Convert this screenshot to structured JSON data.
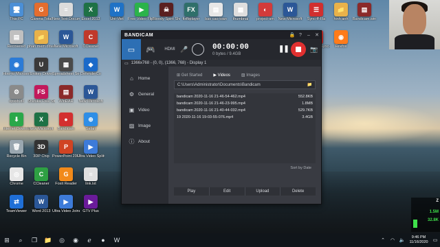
{
  "desktop": {
    "icons": [
      {
        "label": "This PC",
        "glyph": "🖥",
        "color": "#4b8fd6"
      },
      {
        "label": "Garena Total",
        "glyph": "G",
        "color": "#e46d2e"
      },
      {
        "label": "New Text Document",
        "glyph": "≡",
        "color": "#dcdcdc"
      },
      {
        "label": "Excel 2013",
        "glyph": "X",
        "color": "#1e7145"
      },
      {
        "label": "Uni-Viet",
        "glyph": "W",
        "color": "#1f72c6"
      },
      {
        "label": "Free Video Flip and",
        "glyph": "▶",
        "color": "#2bb34a"
      },
      {
        "label": "Bloody Spirit Shooter",
        "glyph": "☠",
        "color": "#5a2020"
      },
      {
        "label": "fixfbplayer",
        "glyph": "FX",
        "color": "#2f6f6a"
      },
      {
        "label": "bao cao toan",
        "glyph": "▤",
        "color": "#e7e7e7"
      },
      {
        "label": "thumbnai",
        "glyph": "▦",
        "color": "#dedede"
      },
      {
        "label": "project-sm",
        "glyph": "◐",
        "color": "#d33b3b"
      },
      {
        "label": "New Microsoft",
        "glyph": "W",
        "color": "#2b5797"
      },
      {
        "label": "Sync-ff-Fla",
        "glyph": "☰",
        "color": "#d12f2f"
      },
      {
        "label": "hinh anh",
        "glyph": "📁",
        "color": "#e8b24a"
      },
      {
        "label": "Bandicam.win",
        "glyph": "▤",
        "color": "#8b2a2a"
      },
      {
        "label": "Recovered",
        "glyph": "▤",
        "color": "#c0c0c0"
      },
      {
        "label": "phan mem driver",
        "glyph": "📁",
        "color": "#e8b24a"
      },
      {
        "label": "New Microsoft",
        "glyph": "W",
        "color": "#2b5797"
      },
      {
        "label": "CCleaner",
        "glyph": "C",
        "color": "#c0392b"
      },
      {
        "label": "How-to Microsoft",
        "glyph": "◉",
        "color": "#2c7bd6"
      },
      {
        "label": "Unikey Driver",
        "glyph": "U",
        "color": "#3a3a3a"
      },
      {
        "label": "Spreadsheet Settings",
        "glyph": "▦",
        "color": "#4a4a4a"
      },
      {
        "label": "DefenderCo",
        "glyph": "◆",
        "color": "#1b6ac9"
      },
      {
        "label": "opsxb.dll",
        "glyph": "⚙",
        "color": "#8a8a8a"
      },
      {
        "label": "Shizuka Free Studio",
        "glyph": "FS",
        "color": "#c2185b"
      },
      {
        "label": "WinRAR",
        "glyph": "▤",
        "color": "#8b2a2a"
      },
      {
        "label": "New Microsoft",
        "glyph": "W",
        "color": "#2b5797"
      },
      {
        "label": "Internet Download",
        "glyph": "⬇",
        "color": "#2aa84a"
      },
      {
        "label": "New Microsoft",
        "glyph": "X",
        "color": "#1e7145"
      },
      {
        "label": "Bandicam",
        "glyph": "●",
        "color": "#d32f2f"
      },
      {
        "label": "Safari",
        "glyph": "⊕",
        "color": "#2f8ee6"
      },
      {
        "label": "Recycle Bin",
        "glyph": "🗑",
        "color": "#9aa7b0"
      },
      {
        "label": "3DP Chip",
        "glyph": "3D",
        "color": "#333333"
      },
      {
        "label": "PowerPoint 2013",
        "glyph": "P",
        "color": "#d04423"
      },
      {
        "label": "Ultra Video Splitter",
        "glyph": "▶",
        "color": "#3d7bd9"
      },
      {
        "label": "Chrome",
        "glyph": "◎",
        "color": "#e6e6e6"
      },
      {
        "label": "CCleaner",
        "glyph": "C",
        "color": "#2ea043"
      },
      {
        "label": "Foxit Reader",
        "glyph": "G",
        "color": "#f28a1a"
      },
      {
        "label": "link.txt",
        "glyph": "≡",
        "color": "#e0e0e0"
      },
      {
        "label": "TeamViewer",
        "glyph": "⇄",
        "color": "#1f6fd6"
      },
      {
        "label": "Word 2013",
        "glyph": "W",
        "color": "#2b5797"
      },
      {
        "label": "Ultra Video Joiner",
        "glyph": "▶",
        "color": "#3d7bd9"
      },
      {
        "label": "GTV Plus",
        "glyph": "▶",
        "color": "#6a1b9a"
      },
      {
        "label": "Download Sync-ff-Fla",
        "glyph": "☰",
        "color": "#d12f2f"
      },
      {
        "label": "Firefox",
        "glyph": "◉",
        "color": "#ff7b1a"
      }
    ]
  },
  "bandicam": {
    "title": "BANDICAM",
    "hdmi_label": "HDMI",
    "timer": "00:00:00",
    "size": "0 bytes / 9.4GB",
    "display_info": "1366x768 - (0, 0), (1366, 768) - Display 1",
    "nav": [
      "Home",
      "General",
      "Video",
      "Image",
      "About"
    ],
    "tabs": [
      "Get Started",
      "Videos",
      "Images"
    ],
    "path": "C:\\Users\\Administrator\\Documents\\Bandicam",
    "files": [
      {
        "name": "bandicam 2020-11-16 21-46-54-462.mp4",
        "size": "552.8KB"
      },
      {
        "name": "bandicam 2020-11-16 21-46-23-995.mp4",
        "size": "1.8MB"
      },
      {
        "name": "bandicam 2020-11-16 21-40-44-032.mp4",
        "size": "529.7KB"
      },
      {
        "name": "19 2020-11-16 19-03-55-076.mp4",
        "size": "3.4GB"
      }
    ],
    "sort_label": "Sort by Date",
    "actions": [
      "Play",
      "Edit",
      "Upload",
      "Delete"
    ]
  },
  "taskbar": {
    "time": "9:46 PM",
    "date": "11/16/2020"
  },
  "netmonitor": {
    "a": "Z",
    "b": "1.5M",
    "c": "32.8K"
  },
  "colors": {
    "record": "#e03030",
    "accent": "#2d6fb4"
  }
}
